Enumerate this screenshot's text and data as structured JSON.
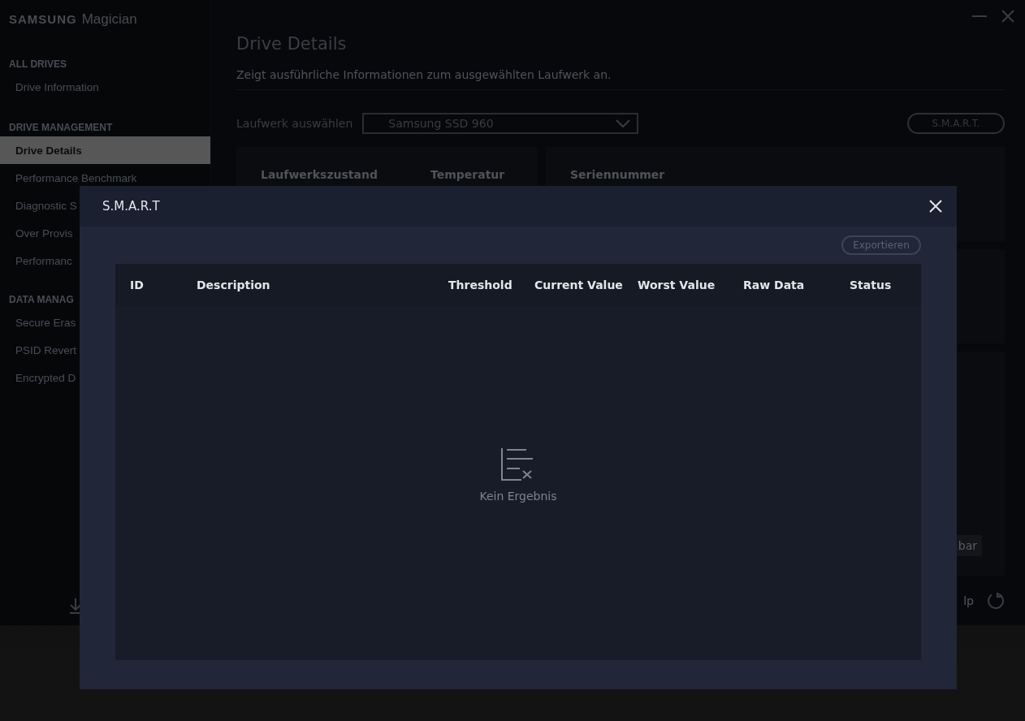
{
  "app": {
    "logo_brand": "SAMSUNG",
    "logo_product": "Magician"
  },
  "sidebar": {
    "sections": [
      {
        "title": "ALL DRIVES",
        "items": [
          {
            "label": "Drive Information",
            "selected": false
          }
        ]
      },
      {
        "title": "DRIVE MANAGEMENT",
        "items": [
          {
            "label": "Drive Details",
            "selected": true
          },
          {
            "label": "Performance Benchmark",
            "selected": false
          },
          {
            "label": "Diagnostic S",
            "selected": false
          },
          {
            "label": "Over Provis",
            "selected": false
          },
          {
            "label": "Performanc",
            "selected": false
          }
        ]
      },
      {
        "title": "DATA MANAG",
        "items": [
          {
            "label": "Secure Eras",
            "selected": false
          },
          {
            "label": "PSID Revert",
            "selected": false
          },
          {
            "label": "Encrypted D",
            "selected": false
          }
        ]
      }
    ]
  },
  "page": {
    "title": "Drive Details",
    "subtitle": "Zeigt ausführliche Informationen zum ausgewählten Laufwerk an.",
    "drive_label": "Laufwerk auswählen",
    "drive_value": "Samsung SSD 960",
    "smart_button": "S.M.A.R.T.",
    "cards": [
      "Laufwerkszustand",
      "Temperatur",
      "Seriennummer"
    ],
    "card_button": "bar",
    "footer_link": "lp"
  },
  "dialog": {
    "title": "S.M.A.R.T",
    "export_button": "Exportieren",
    "columns": [
      "ID",
      "Description",
      "Threshold",
      "Current Value",
      "Worst Value",
      "Raw Data",
      "Status"
    ],
    "empty_text": "Kein Ergebnis"
  }
}
